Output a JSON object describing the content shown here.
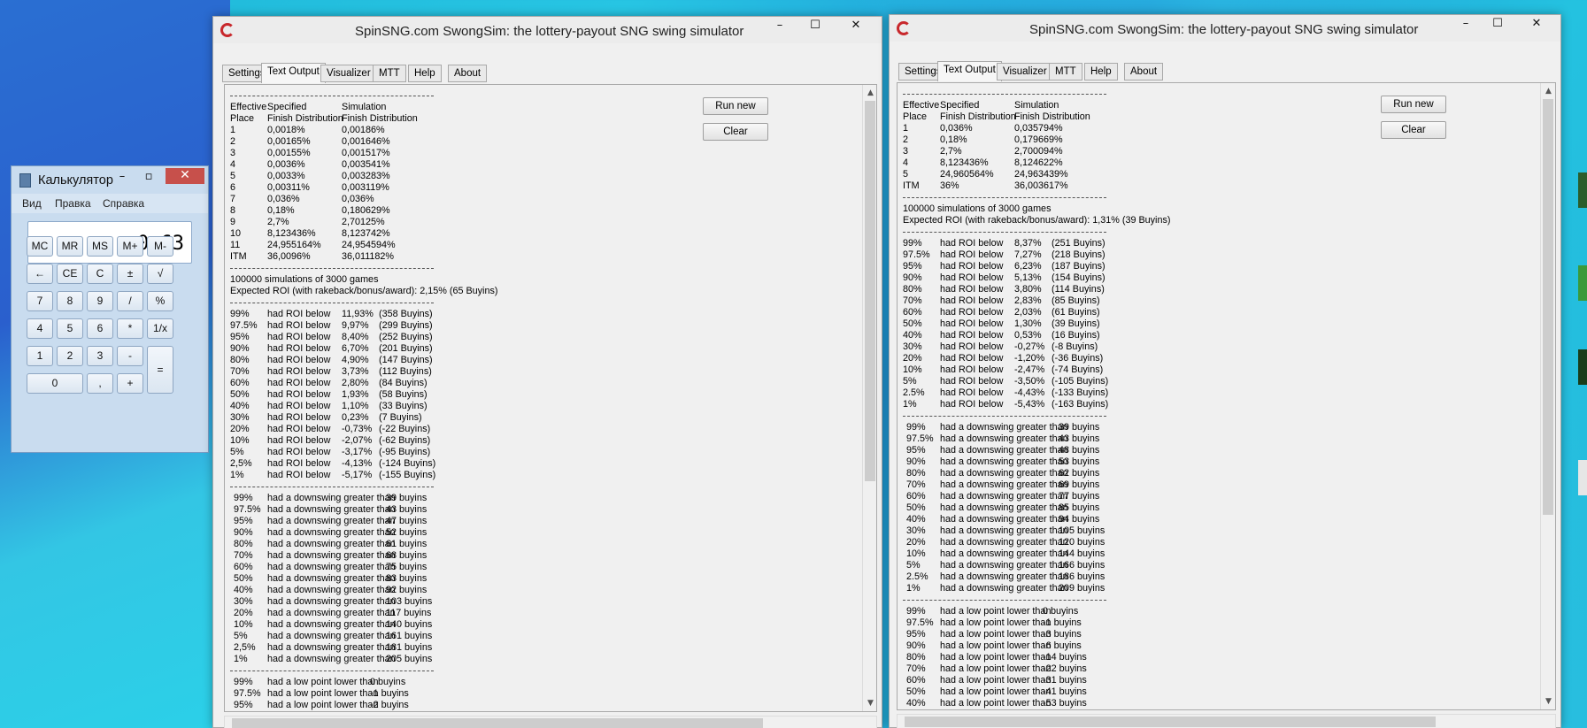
{
  "calculator": {
    "title": "Калькулятор",
    "menu": [
      "Вид",
      "Правка",
      "Справка"
    ],
    "display": "0,63",
    "keys": [
      [
        "MC",
        "MR",
        "MS",
        "M+",
        "M-"
      ],
      [
        "←",
        "CE",
        "C",
        "±",
        "√"
      ],
      [
        "7",
        "8",
        "9",
        "/",
        "%"
      ],
      [
        "4",
        "5",
        "6",
        "*",
        "1/x"
      ],
      [
        "1",
        "2",
        "3",
        "-",
        "="
      ],
      [
        "0",
        ",",
        "+"
      ]
    ]
  },
  "window_left": {
    "title": "SpinSNG.com    SwongSim: the lottery-payout SNG swing simulator",
    "tabs": [
      "Settings",
      "Text Output",
      "Visualizer",
      "MTT",
      "Help",
      "About"
    ],
    "active_tab": "Text Output",
    "buttons": {
      "run": "Run new",
      "clear": "Clear"
    },
    "header": {
      "c1a": "Effective",
      "c1b": "Place",
      "c2a": "Specified",
      "c2b": "Finish Distribution",
      "c3a": "Simulation",
      "c3b": "Finish Distribution"
    },
    "places": [
      [
        "1",
        "0,0018%",
        "0,00186%"
      ],
      [
        "2",
        "0,00165%",
        "0,001646%"
      ],
      [
        "3",
        "0,00155%",
        "0,001517%"
      ],
      [
        "4",
        "0,0036%",
        "0,003541%"
      ],
      [
        "5",
        "0,0033%",
        "0,003283%"
      ],
      [
        "6",
        "0,00311%",
        "0,003119%"
      ],
      [
        "7",
        "0,036%",
        "0,036%"
      ],
      [
        "8",
        "0,18%",
        "0,180629%"
      ],
      [
        "9",
        "2,7%",
        "2,70125%"
      ],
      [
        "10",
        "8,123436%",
        "8,123742%"
      ],
      [
        "11",
        "24,955164%",
        "24,954594%"
      ],
      [
        "ITM",
        "36,0096%",
        "36,011182%"
      ]
    ],
    "sim_line": "100000  simulations of  3000  games",
    "roi_line": "Expected ROI (with rakeback/bonus/award): 2,15%  (65 Buyins)",
    "roi_rows": [
      [
        "99%",
        "had ROI below",
        "11,93%",
        "(358 Buyins)"
      ],
      [
        "97.5%",
        "had ROI below",
        "9,97%",
        "(299 Buyins)"
      ],
      [
        "95%",
        "had ROI below",
        "8,40%",
        "(252 Buyins)"
      ],
      [
        "90%",
        "had ROI below",
        "6,70%",
        "(201 Buyins)"
      ],
      [
        "80%",
        "had ROI below",
        "4,90%",
        "(147 Buyins)"
      ],
      [
        "70%",
        "had ROI below",
        "3,73%",
        "(112 Buyins)"
      ],
      [
        "60%",
        "had ROI below",
        "2,80%",
        "(84 Buyins)"
      ],
      [
        "50%",
        "had ROI below",
        "1,93%",
        "(58 Buyins)"
      ],
      [
        "40%",
        "had ROI below",
        "1,10%",
        "(33 Buyins)"
      ],
      [
        "30%",
        "had ROI below",
        "0,23%",
        "(7 Buyins)"
      ],
      [
        "20%",
        "had ROI below",
        "-0,73%",
        "(-22 Buyins)"
      ],
      [
        "10%",
        "had ROI below",
        "-2,07%",
        "(-62 Buyins)"
      ],
      [
        " 5%",
        "had ROI below",
        "-3,17%",
        "(-95 Buyins)"
      ],
      [
        " 2,5%",
        "had ROI below",
        "-4,13%",
        "(-124 Buyins)"
      ],
      [
        " 1%",
        "had ROI below",
        "-5,17%",
        "(-155 Buyins)"
      ]
    ],
    "down_rows": [
      [
        "99%",
        "had a downswing greater than",
        "39 buyins"
      ],
      [
        "97.5%",
        "had a downswing greater than",
        "43 buyins"
      ],
      [
        "95%",
        "had a downswing greater than",
        "47 buyins"
      ],
      [
        "90%",
        "had a downswing greater than",
        "52 buyins"
      ],
      [
        "80%",
        "had a downswing greater than",
        "61 buyins"
      ],
      [
        "70%",
        "had a downswing greater than",
        "68 buyins"
      ],
      [
        "60%",
        "had a downswing greater than",
        "75 buyins"
      ],
      [
        "50%",
        "had a downswing greater than",
        "83 buyins"
      ],
      [
        "40%",
        "had a downswing greater than",
        "92 buyins"
      ],
      [
        "30%",
        "had a downswing greater than",
        "103 buyins"
      ],
      [
        "20%",
        "had a downswing greater than",
        "117 buyins"
      ],
      [
        "10%",
        "had a downswing greater than",
        "140 buyins"
      ],
      [
        "5%",
        "had a downswing greater than",
        "161 buyins"
      ],
      [
        "2,5%",
        "had a downswing greater than",
        "181 buyins"
      ],
      [
        "1%",
        "had a downswing greater than",
        "205 buyins"
      ]
    ],
    "low_rows": [
      [
        "99%",
        "had a low point lower than",
        "0 buyins"
      ],
      [
        "97.5%",
        "had a low point lower than",
        "-1 buyins"
      ],
      [
        "95%",
        "had a low point lower than",
        "-2 buyins"
      ]
    ]
  },
  "window_right": {
    "title": "SpinSNG.com    SwongSim: the lottery-payout SNG swing simulator",
    "tabs": [
      "Settings",
      "Text Output",
      "Visualizer",
      "MTT",
      "Help",
      "About"
    ],
    "active_tab": "Text Output",
    "buttons": {
      "run": "Run new",
      "clear": "Clear"
    },
    "header": {
      "c1a": "Effective",
      "c1b": "Place",
      "c2a": "Specified",
      "c2b": "Finish Distribution",
      "c3a": "Simulation",
      "c3b": "Finish Distribution"
    },
    "places": [
      [
        "1",
        "0,036%",
        "0,035794%"
      ],
      [
        "2",
        "0,18%",
        "0,179669%"
      ],
      [
        "3",
        "2,7%",
        "2,700094%"
      ],
      [
        "4",
        "8,123436%",
        "8,124622%"
      ],
      [
        "5",
        "24,960564%",
        "24,963439%"
      ],
      [
        "ITM",
        "36%",
        "36,003617%"
      ]
    ],
    "sim_line": "100000  simulations of  3000  games",
    "roi_line": "Expected ROI (with rakeback/bonus/award): 1,31%  (39 Buyins)",
    "roi_rows": [
      [
        "99%",
        "had ROI below",
        "8,37%",
        "(251 Buyins)"
      ],
      [
        "97.5%",
        "had ROI below",
        "7,27%",
        "(218 Buyins)"
      ],
      [
        "95%",
        "had ROI below",
        "6,23%",
        "(187 Buyins)"
      ],
      [
        "90%",
        "had ROI below",
        "5,13%",
        "(154 Buyins)"
      ],
      [
        "80%",
        "had ROI below",
        "3,80%",
        "(114 Buyins)"
      ],
      [
        "70%",
        "had ROI below",
        "2,83%",
        "(85 Buyins)"
      ],
      [
        "60%",
        "had ROI below",
        "2,03%",
        "(61 Buyins)"
      ],
      [
        "50%",
        "had ROI below",
        "1,30%",
        "(39 Buyins)"
      ],
      [
        "40%",
        "had ROI below",
        "0,53%",
        "(16 Buyins)"
      ],
      [
        "30%",
        "had ROI below",
        "-0,27%",
        "(-8 Buyins)"
      ],
      [
        "20%",
        "had ROI below",
        "-1,20%",
        "(-36 Buyins)"
      ],
      [
        "10%",
        "had ROI below",
        "-2,47%",
        "(-74 Buyins)"
      ],
      [
        " 5%",
        "had ROI below",
        "-3,50%",
        "(-105 Buyins)"
      ],
      [
        " 2.5%",
        "had ROI below",
        "-4,43%",
        "(-133 Buyins)"
      ],
      [
        " 1%",
        "had ROI below",
        "-5,43%",
        "(-163 Buyins)"
      ]
    ],
    "down_rows": [
      [
        "99%",
        "had a downswing greater than",
        "39 buyins"
      ],
      [
        "97.5%",
        "had a downswing greater than",
        "43 buyins"
      ],
      [
        "95%",
        "had a downswing greater than",
        "48 buyins"
      ],
      [
        "90%",
        "had a downswing greater than",
        "53 buyins"
      ],
      [
        "80%",
        "had a downswing greater than",
        "62 buyins"
      ],
      [
        "70%",
        "had a downswing greater than",
        "69 buyins"
      ],
      [
        "60%",
        "had a downswing greater than",
        "77 buyins"
      ],
      [
        "50%",
        "had a downswing greater than",
        "85 buyins"
      ],
      [
        "40%",
        "had a downswing greater than",
        "94 buyins"
      ],
      [
        "30%",
        "had a downswing greater than",
        "105 buyins"
      ],
      [
        "20%",
        "had a downswing greater than",
        "120 buyins"
      ],
      [
        "10%",
        "had a downswing greater than",
        "144 buyins"
      ],
      [
        "5%",
        "had a downswing greater than",
        "166 buyins"
      ],
      [
        "2.5%",
        "had a downswing greater than",
        "186 buyins"
      ],
      [
        "1%",
        "had a downswing greater than",
        "209 buyins"
      ]
    ],
    "low_rows": [
      [
        "99%",
        "had a low point lower than",
        "0 buyins"
      ],
      [
        "97.5%",
        "had a low point lower than",
        "-1 buyins"
      ],
      [
        "95%",
        "had a low point lower than",
        "-3 buyins"
      ],
      [
        "90%",
        "had a low point lower than",
        "-6 buyins"
      ],
      [
        "80%",
        "had a low point lower than",
        "-14 buyins"
      ],
      [
        "70%",
        "had a low point lower than",
        "-22 buyins"
      ],
      [
        "60%",
        "had a low point lower than",
        "-31 buyins"
      ],
      [
        "50%",
        "had a low point lower than",
        "-41 buyins"
      ],
      [
        "40%",
        "had a low point lower than",
        "-53 buyins"
      ]
    ]
  }
}
